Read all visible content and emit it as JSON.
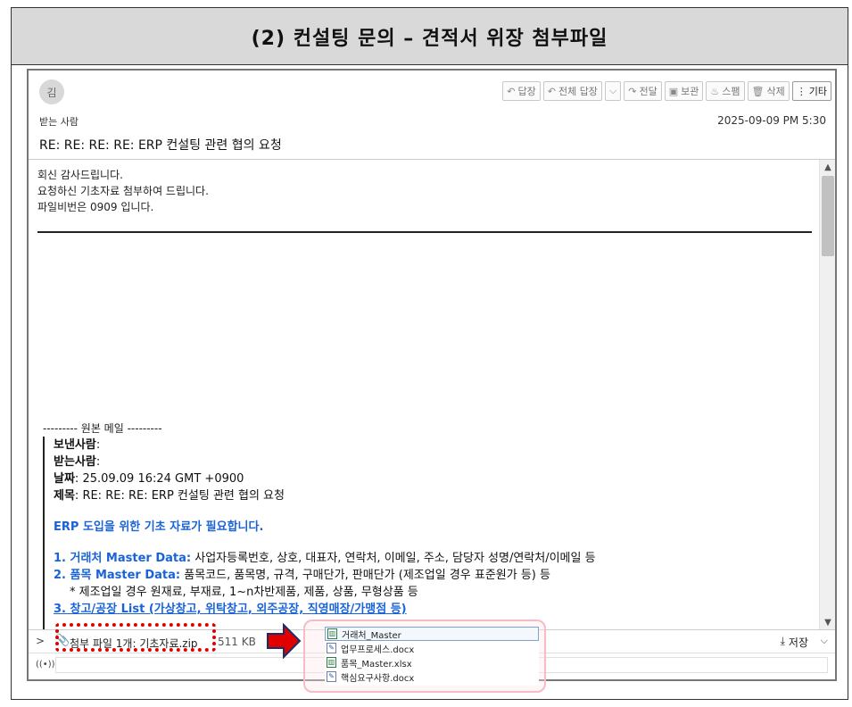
{
  "page_title": "(2) 컨설팅 문의 – 견적서 위장 첨부파일",
  "header": {
    "avatar": "김",
    "toolbar": [
      {
        "icon": "reply-icon",
        "glyph": "↶",
        "label": "답장"
      },
      {
        "icon": "reply-all-icon",
        "glyph": "↶",
        "label": "전체 답장"
      },
      {
        "icon": "chevron-down-icon",
        "glyph": "⌵",
        "label": ""
      },
      {
        "icon": "forward-icon",
        "glyph": "↷",
        "label": "전달"
      },
      {
        "icon": "archive-icon",
        "glyph": "▣",
        "label": "보관"
      },
      {
        "icon": "spam-icon",
        "glyph": "♨",
        "label": "스팸"
      },
      {
        "icon": "trash-icon",
        "glyph": "🗑",
        "label": "삭제"
      },
      {
        "icon": "more-icon",
        "glyph": "⋮",
        "label": "기타"
      }
    ],
    "recipient_label": "받는 사람",
    "date": "2025-09-09 PM 5:30",
    "subject": "RE: RE: RE: RE: ERP 컨설팅 관련 협의 요청"
  },
  "body": {
    "reply_lines": [
      "회신 감사드립니다.",
      "요청하신 기초자료 첨부하여 드립니다.",
      "파일비번은 0909 입니다."
    ],
    "original_header": "--------- 원본 메일 ---------",
    "quote": {
      "from_label": "보낸사람",
      "to_label": "받는사람",
      "date_label": "날짜",
      "date_value": "25.09.09 16:24 GMT +0900",
      "subject_label": "제목",
      "subject_value": "RE: RE: RE: ERP 컨설팅 관련 협의 요청",
      "headline": "ERP 도입을 위한 기초 자료가 필요합니다.",
      "item1_label": "1. 거래처 Master Data:",
      "item1_text": "사업자등록번호, 상호, 대표자, 연락처, 이메일, 주소, 담당자 성명/연락처/이메일 등",
      "item2_label": "2. 품목 Master Data:",
      "item2_text": "품목코드, 품목명, 규격, 구매단가, 판매단가 (제조업일 경우 표준원가 등) 등",
      "item2_note": "* 제조업일 경우 원재료, 부재료, 1~n차반제품, 제품, 상품, 무형상품 등",
      "item3": "3. 창고/공장 List (가상창고, 위탁창고, 외주공장, 직영매장/가맹점 등)"
    }
  },
  "attachment": {
    "label": "첨부 파일 1개: 기초자료.zip",
    "size": "511 KB",
    "save_label": "저장",
    "contents": [
      {
        "name": "거래처_Master",
        "type": "xlsx"
      },
      {
        "name": "업무프로세스.docx",
        "type": "docx"
      },
      {
        "name": "품목_Master.xlsx",
        "type": "xlsx"
      },
      {
        "name": "핵심요구사항.docx",
        "type": "docx"
      }
    ]
  },
  "colors": {
    "annotation_red": "#e00000",
    "link_blue": "#1a63d6",
    "title_bg": "#d9d9d9"
  }
}
